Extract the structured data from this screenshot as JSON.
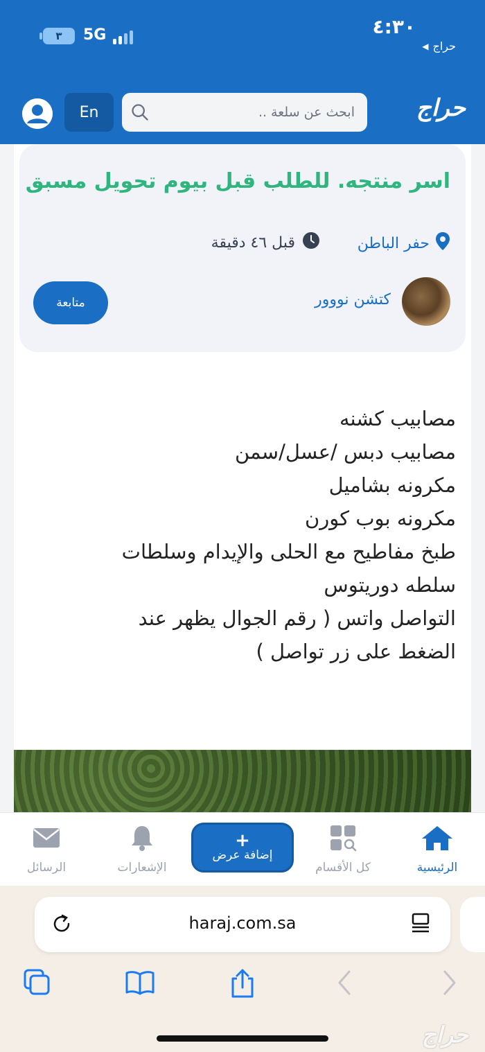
{
  "status_bar": {
    "time": "٤:٣٠",
    "back_app": "حراج",
    "battery": "٣",
    "network": "5G"
  },
  "header": {
    "logo": "حراج",
    "search_placeholder": "ابحث عن سلعة ..",
    "lang_button": "En"
  },
  "post": {
    "title": "اسر منتجه. للطلب قبل بيوم تحويل مسبق",
    "location": "حفر الباطن",
    "time_ago": "قبل ٤٦ دقيقة",
    "author": "كتشن نووور",
    "follow_label": "متابعة",
    "body_lines": [
      "مصابيب كشنه",
      "مصابيب دبس /عسل/سمن",
      "مكرونه بشاميل",
      "مكرونه بوب كورن",
      "طبخ مفاطيح مع الحلى والإيدام وسلطات",
      "سلطه دوريتوس",
      "التواصل واتس  ( رقم الجوال يظهر عند",
      "الضغط على زر تواصل )"
    ]
  },
  "bottom_nav": {
    "home": "الرئيسية",
    "categories": "كل الأقسام",
    "add_offer": "إضافة عرض",
    "notifications": "الإشعارات",
    "messages": "الرسائل"
  },
  "browser": {
    "url": "haraj.com.sa"
  },
  "watermark": "حراج",
  "colors": {
    "brand_blue": "#1a6fc4",
    "title_green": "#2fb57d"
  }
}
